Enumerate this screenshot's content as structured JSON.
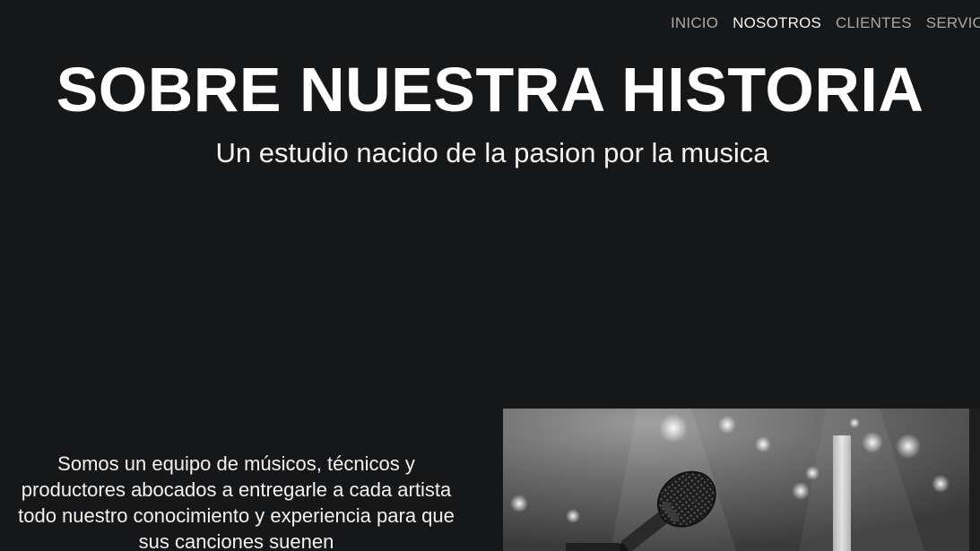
{
  "nav": {
    "items": [
      {
        "label": "INICIO",
        "active": false
      },
      {
        "label": "NOSOTROS",
        "active": true
      },
      {
        "label": "CLIENTES",
        "active": false
      },
      {
        "label": "SERVICIOS",
        "active": false
      }
    ]
  },
  "hero": {
    "title": "SOBRE NUESTRA HISTORIA",
    "subtitle": "Un estudio nacido de la pasion por la musica"
  },
  "about": {
    "paragraph": "Somos un equipo de músicos, técnicos y productores abocados a entregarle a cada artista todo nuestro conocimiento y experiencia para que sus canciones suenen"
  },
  "photo": {
    "subject": "microphone-on-stage",
    "tone": "black-and-white"
  },
  "colors": {
    "background": "#161719",
    "nav_inactive": "#a9a9a9",
    "nav_active": "#f4f4f4",
    "text": "#ffffff"
  }
}
